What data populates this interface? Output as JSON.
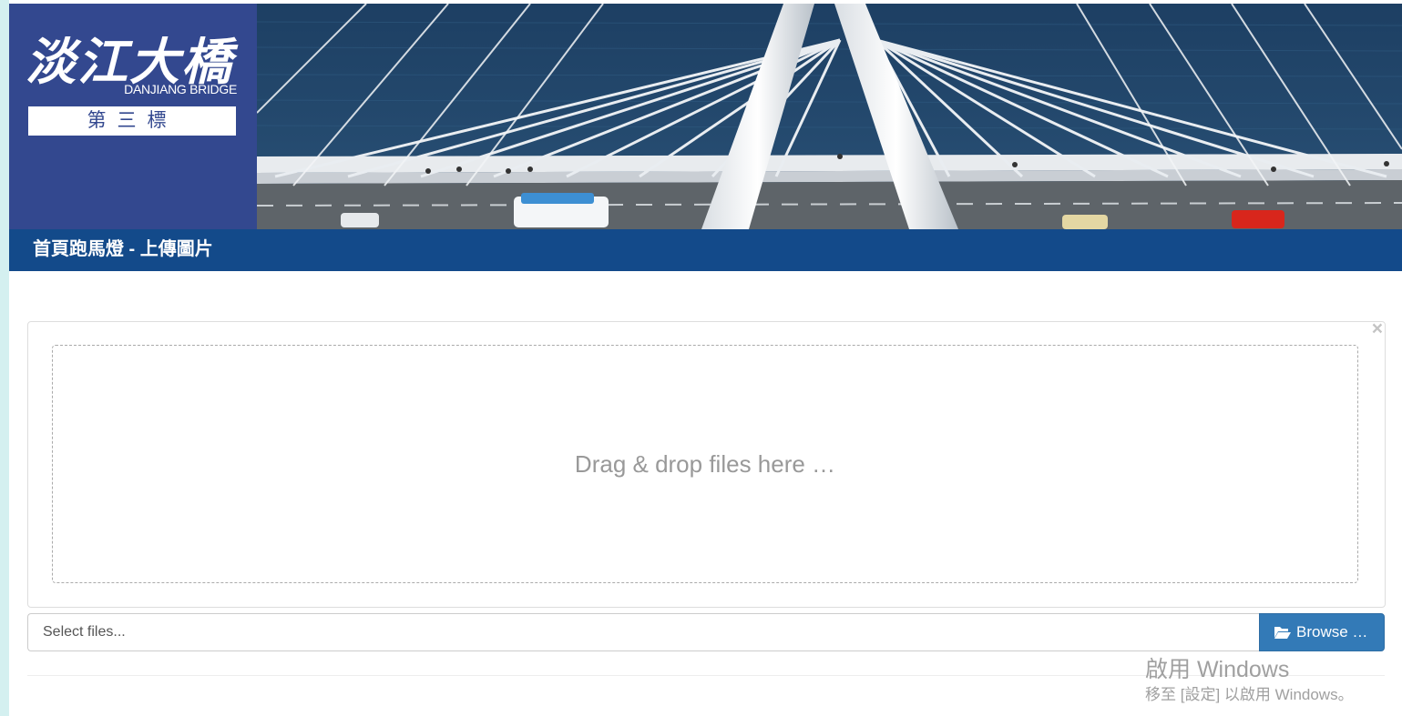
{
  "banner": {
    "logo_title": "淡江大橋",
    "logo_subtitle": "DANJIANG BRIDGE",
    "logo_section": "第三標",
    "photo_alt": "bridge-photo"
  },
  "title_bar": {
    "title": "首頁跑馬燈 - 上傳圖片"
  },
  "uploader": {
    "close_symbol": "×",
    "drop_text": "Drag & drop files here …",
    "caption_placeholder": "Select files...",
    "browse_label": "Browse …",
    "browse_icon": "folder-open-icon"
  },
  "watermark": {
    "line1": "啟用 Windows",
    "line2": "移至 [設定] 以啟用 Windows。"
  },
  "colors": {
    "logo_panel": "#33488f",
    "title_bar": "#134a8a",
    "browse_button": "#337ab7",
    "page_side": "#d4f0f0"
  }
}
